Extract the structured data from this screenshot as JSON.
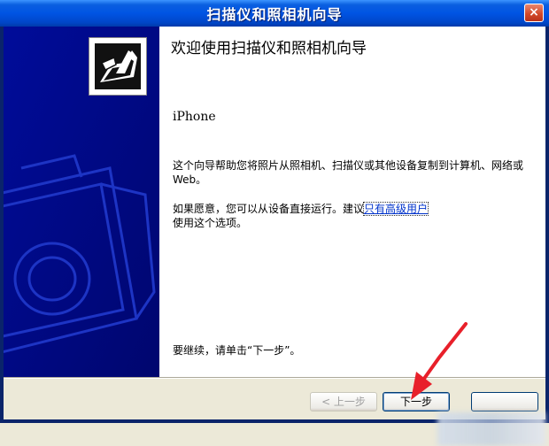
{
  "window": {
    "title": "扫描仪和照相机向导",
    "close_label": "×"
  },
  "content": {
    "heading": "欢迎使用扫描仪和照相机向导",
    "device_name": "iPhone",
    "description": "这个向导帮助您将照片从照相机、扫描仪或其他设备复制到计算机、网络或 Web。",
    "advanced_prefix": "如果愿意，您可以从设备直接运行。建议",
    "advanced_link": "只有高级用户",
    "advanced_suffix": "使用这个选项。",
    "continue_text": "要继续，请单击“下一步”。"
  },
  "buttons": {
    "back": "< 上一步",
    "next": "下一步",
    "cancel": ""
  },
  "icons": {
    "wizard": "camera-wizard-icon",
    "close": "close-icon"
  },
  "colors": {
    "titlebar": "#0054e3",
    "left_panel": "#000a8a",
    "link": "#0033cc",
    "annotation_arrow": "#e8202a"
  }
}
